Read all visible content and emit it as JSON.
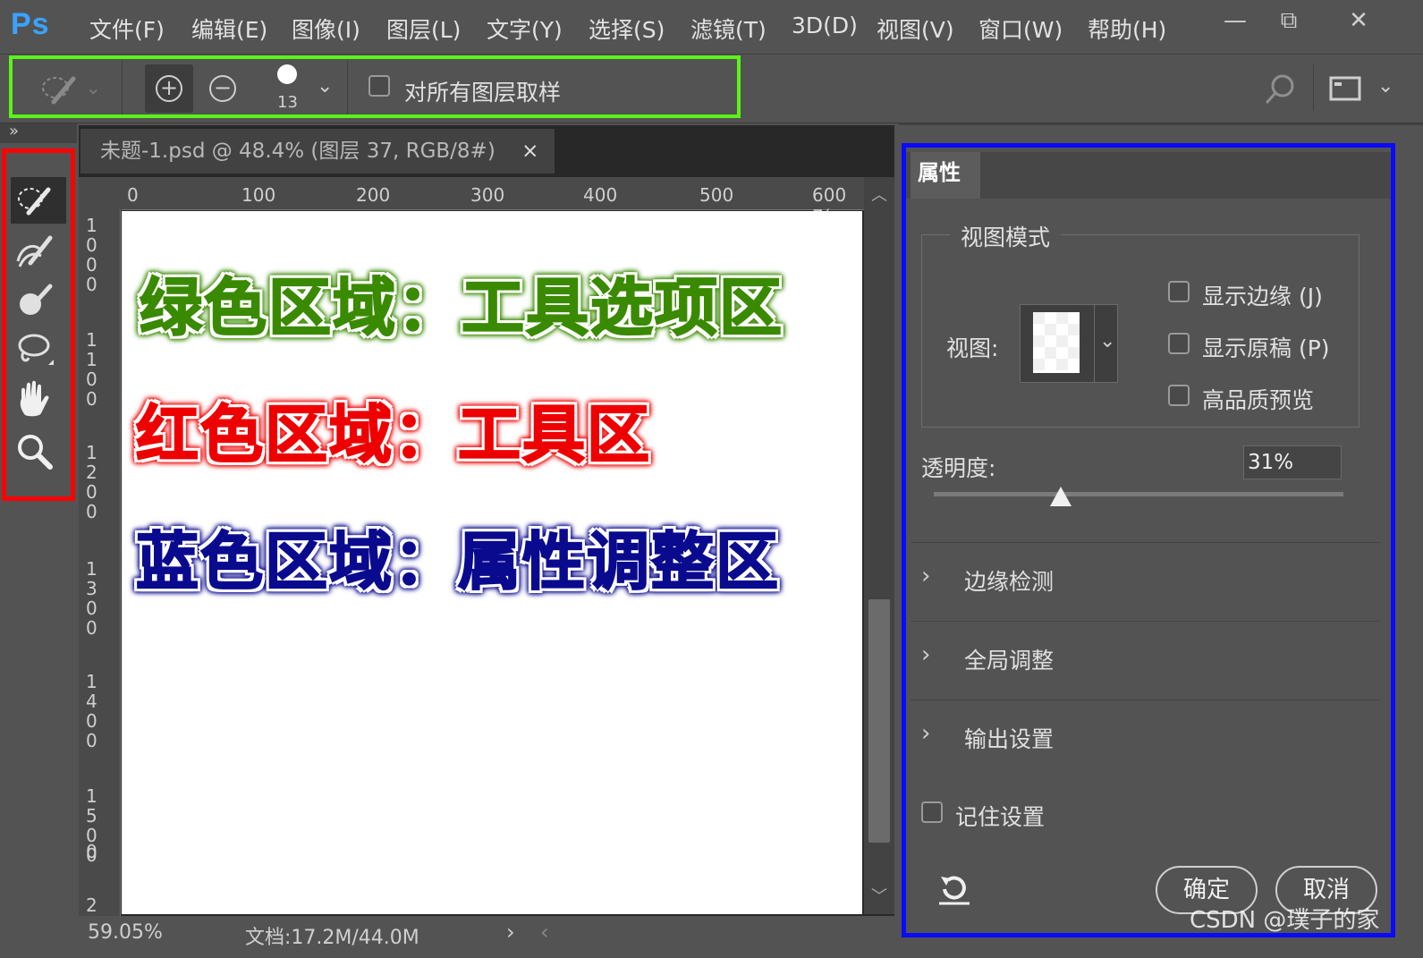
{
  "app": {
    "logo": "Ps"
  },
  "menu": [
    "文件(F)",
    "编辑(E)",
    "图像(I)",
    "图层(L)",
    "文字(Y)",
    "选择(S)",
    "滤镜(T)",
    "3D(D)",
    "视图(V)",
    "窗口(W)",
    "帮助(H)"
  ],
  "window_controls": {
    "minimize": "—",
    "restore": "⧉",
    "close": "✕"
  },
  "options_bar": {
    "brush_size": "13",
    "sample_all_layers_label": "对所有图层取样",
    "sample_all_layers_checked": false,
    "add_mode_symbol": "+",
    "subtract_mode_symbol": "−",
    "dropdown_symbol": "⌄"
  },
  "collapse_glyph": "»",
  "document": {
    "tab_title": "未题-1.psd @ 48.4% (图层 37, RGB/8#)",
    "tab_close": "×",
    "ruler_h": [
      "0",
      "100",
      "200",
      "300",
      "400",
      "500",
      "600 7("
    ],
    "ruler_v": [
      [
        "1",
        "0",
        "0",
        "0"
      ],
      [
        "1",
        "1",
        "0",
        "0"
      ],
      [
        "1",
        "2",
        "0",
        "0"
      ],
      [
        "1",
        "3",
        "0",
        "0"
      ],
      [
        "1",
        "4",
        "0",
        "0"
      ],
      [
        "1",
        "5",
        "0",
        "0"
      ],
      [
        "0"
      ],
      [
        "2"
      ]
    ],
    "zoom": "59.05%",
    "doc_size": "文档:17.2M/44.0M",
    "status_arrows": {
      "right": "›",
      "left": "‹"
    },
    "scroll_arrows": {
      "up": "︿",
      "down": "﹀"
    }
  },
  "annotations": {
    "green": {
      "text": "绿色区域：工具选项区",
      "color": "#3a8a00"
    },
    "red": {
      "text": "红色区域：工具区",
      "color": "#ee0000"
    },
    "blue": {
      "text": "蓝色区域：属性调整区",
      "color": "#0a0a8e"
    }
  },
  "colors": {
    "green_frame": "#5bf31a",
    "red_frame": "#ff0000",
    "blue_frame": "#0a0aff",
    "ui_bg": "#535353",
    "accent_logo": "#3aa3ff"
  },
  "tools": [
    "quick-selection-icon",
    "brush-refine-icon",
    "brush-icon",
    "lasso-icon",
    "hand-icon",
    "zoom-icon"
  ],
  "properties": {
    "tab": "属性",
    "view_mode_title": "视图模式",
    "view_label": "视图:",
    "show_edge": "显示边缘 (J)",
    "show_original": "显示原稿 (P)",
    "high_quality_preview": "高品质预览",
    "opacity_label": "透明度:",
    "opacity_value": "31%",
    "opacity_level": 0.31,
    "sections": [
      "边缘检测",
      "全局调整",
      "输出设置"
    ],
    "remember_settings": "记住设置",
    "ok": "确定",
    "cancel": "取消"
  },
  "watermark": "CSDN @璞子的家"
}
